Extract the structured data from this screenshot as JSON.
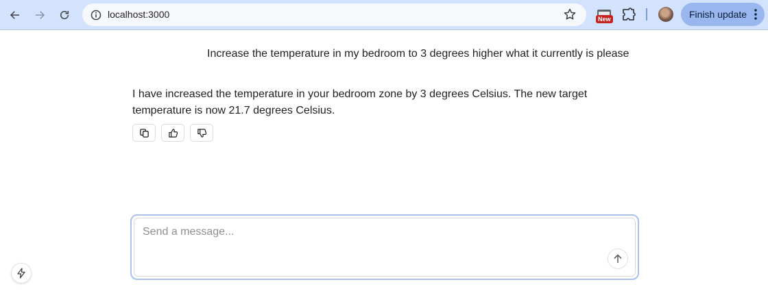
{
  "browser": {
    "url": "localhost:3000",
    "new_badge": "New",
    "update_label": "Finish update",
    "icons": [
      "back-icon",
      "forward-icon",
      "reload-icon",
      "site-info-icon",
      "star-icon",
      "extension-icon",
      "puzzle-icon",
      "avatar",
      "more-vertical-icon"
    ]
  },
  "chat": {
    "user_message": "Increase the temperature in my bedroom to 3 degrees higher what it currently is please",
    "assistant_message": "I have increased the temperature in your bedroom zone by 3 degrees Celsius. The new target temperature is now 21.7 degrees Celsius.",
    "actions": [
      "copy-icon",
      "thumbs-up-icon",
      "thumbs-down-icon"
    ]
  },
  "composer": {
    "placeholder": "Send a message...",
    "value": ""
  },
  "colors": {
    "toolbar_bg": "#d3e3fd",
    "update_button_bg": "#9ab6ee",
    "composer_border": "#a8c2ec"
  }
}
